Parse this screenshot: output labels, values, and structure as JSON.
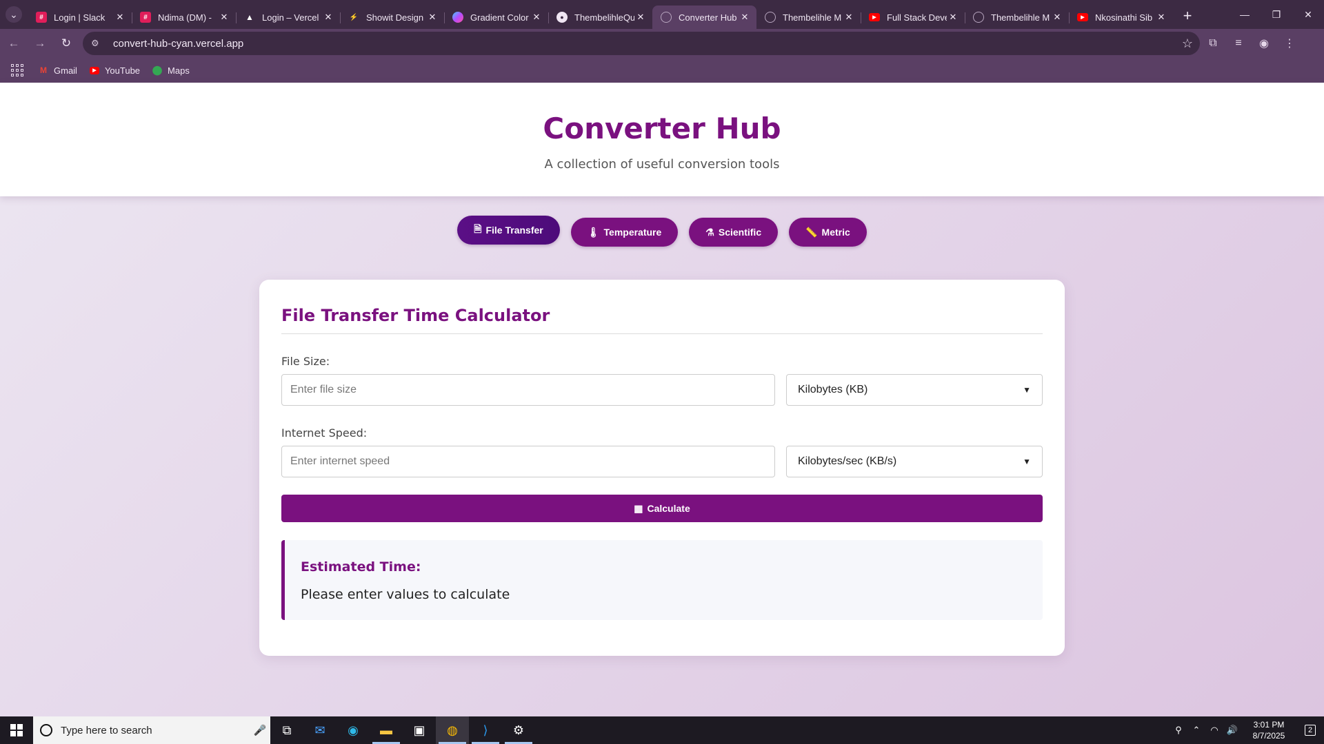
{
  "browser": {
    "tabs": [
      {
        "title": "Login | Slack",
        "favicon": "slack-icon",
        "color": "#e01e5a"
      },
      {
        "title": "Ndima (DM) - ",
        "favicon": "slack-icon",
        "color": "#e01e5a"
      },
      {
        "title": "Login – Vercel",
        "favicon": "vercel-icon",
        "color": "#000000"
      },
      {
        "title": "Showit Design",
        "favicon": "showit-icon",
        "color": "#222222"
      },
      {
        "title": "Gradient Color",
        "favicon": "gradient-icon",
        "color": "#7b5cff"
      },
      {
        "title": "ThembelihleQu",
        "favicon": "github-icon",
        "color": "#000000"
      },
      {
        "title": "Converter Hub",
        "favicon": "globe-icon",
        "color": "#8d7a94",
        "active": true
      },
      {
        "title": "Thembelihle M",
        "favicon": "globe-icon",
        "color": "#8d7a94"
      },
      {
        "title": "Full Stack Deve",
        "favicon": "youtube-icon",
        "color": "#ff0000"
      },
      {
        "title": "Thembelihle M",
        "favicon": "globe-icon",
        "color": "#8d7a94"
      },
      {
        "title": "Nkosinathi Sib",
        "favicon": "youtube-icon",
        "color": "#ff0000"
      }
    ],
    "url": "convert-hub-cyan.vercel.app",
    "bookmarks": [
      {
        "label": "Gmail",
        "icon": "gmail-icon"
      },
      {
        "label": "YouTube",
        "icon": "youtube-icon"
      },
      {
        "label": "Maps",
        "icon": "maps-icon"
      }
    ]
  },
  "header": {
    "title": "Converter Hub",
    "subtitle": "A collection of useful conversion tools"
  },
  "nav": {
    "items": [
      {
        "label": "File Transfer",
        "icon": "file-export-icon",
        "active": true
      },
      {
        "label": "Temperature",
        "icon": "thermometer-icon"
      },
      {
        "label": "Scientific",
        "icon": "flask-icon"
      },
      {
        "label": "Metric",
        "icon": "ruler-icon"
      }
    ]
  },
  "calculator": {
    "title": "File Transfer Time Calculator",
    "file_size": {
      "label": "File Size:",
      "placeholder": "Enter file size",
      "value": "",
      "unit": "Kilobytes (KB)"
    },
    "internet_speed": {
      "label": "Internet Speed:",
      "placeholder": "Enter internet speed",
      "value": "",
      "unit": "Kilobytes/sec (KB/s)"
    },
    "button_label": "Calculate",
    "result": {
      "title": "Estimated Time:",
      "text": "Please enter values to calculate"
    }
  },
  "taskbar": {
    "search_placeholder": "Type here to search",
    "time": "3:01 PM",
    "date": "8/7/2025",
    "notification_count": "2"
  },
  "colors": {
    "accent": "#7a117f",
    "active_pill": "#5b0f86",
    "chrome_dark": "#3c2a43",
    "chrome_light": "#5a3f64"
  }
}
